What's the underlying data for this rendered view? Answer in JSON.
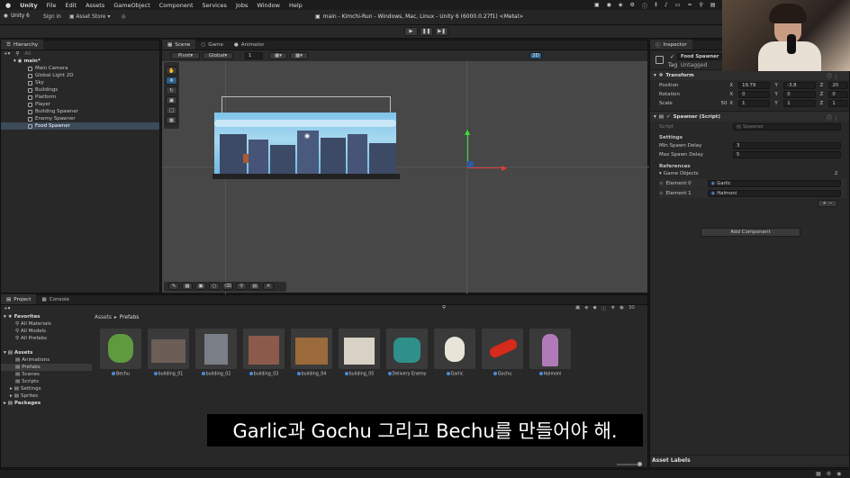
{
  "menubar": {
    "app": "Unity",
    "items": [
      "File",
      "Edit",
      "Assets",
      "GameObject",
      "Component",
      "Services",
      "Jobs",
      "Window",
      "Help"
    ],
    "lang": "A"
  },
  "titlebar": {
    "account": "Unity 6",
    "sign_in": "Sign in",
    "asset_store": "Asset Store",
    "title": "main - Kimchi-Run - Windows, Mac, Linux - Unity 6 (6000.0.27f1) <Metal>"
  },
  "hierarchy": {
    "tab": "Hierarchy",
    "search": "All",
    "scene": "main*",
    "items": [
      "Main Camera",
      "Global Light 2D",
      "Sky",
      "Buildings",
      "Platform",
      "Player",
      "Building Spawner",
      "Enemy Spawner",
      "Food Spawner"
    ],
    "selected": "Food Spawner"
  },
  "scene": {
    "tabs": [
      "Scene",
      "Game",
      "Animator"
    ],
    "pivot": "Pivot",
    "global": "Global",
    "snap": "1",
    "mode2d": "2D"
  },
  "inspector": {
    "tab": "Inspector",
    "object_name": "Food Spawner",
    "tag_label": "Tag",
    "tag_value": "Untagged",
    "transform": {
      "title": "Transform",
      "position_label": "Position",
      "rotation_label": "Rotation",
      "scale_label": "Scale",
      "scale_mark": "50",
      "position": {
        "x": "19.79",
        "y": "-3.8",
        "z": "20"
      },
      "rotation": {
        "x": "0",
        "y": "0",
        "z": "0"
      },
      "scale": {
        "x": "1",
        "y": "1",
        "z": "1"
      }
    },
    "script": {
      "title": "Spawner (Script)",
      "script_label": "Script",
      "script_value": "Spawner",
      "settings_header": "Settings",
      "min_label": "Min Spawn Delay",
      "min_value": "3",
      "max_label": "Max Spawn Delay",
      "max_value": "5",
      "refs_header": "References",
      "list_label": "Game Objects",
      "list_count": "2",
      "e0_label": "Element 0",
      "e0_value": "Garlic",
      "e1_label": "Element 1",
      "e1_value": "Halmoni"
    },
    "add_component": "Add Component",
    "asset_labels": "Asset Labels"
  },
  "project": {
    "tabs": [
      "Project",
      "Console"
    ],
    "favorites": "Favorites",
    "fav_items": [
      "All Materials",
      "All Models",
      "All Prefabs"
    ],
    "assets": "Assets",
    "asset_folders": [
      "Animations",
      "Prefabs",
      "Scenes",
      "Scripts",
      "Settings",
      "Sprites"
    ],
    "packages": "Packages",
    "breadcrumb_root": "Assets",
    "breadcrumb_current": "Prefabs",
    "count": "30",
    "prefabs": [
      "Bechu",
      "building_01",
      "building_02",
      "building_03",
      "building_04",
      "building_05",
      "Delivery Enemy",
      "Garlic",
      "Gochu",
      "Halmoni"
    ]
  },
  "subtitle": "Garlic과 Gochu 그리고 Bechu를 만들어야 해.",
  "colors": {
    "accent": "#2c5d87",
    "sky": "#6ab4e0",
    "gizmo_y": "#3adf3a",
    "gizmo_x": "#e03a3a"
  }
}
